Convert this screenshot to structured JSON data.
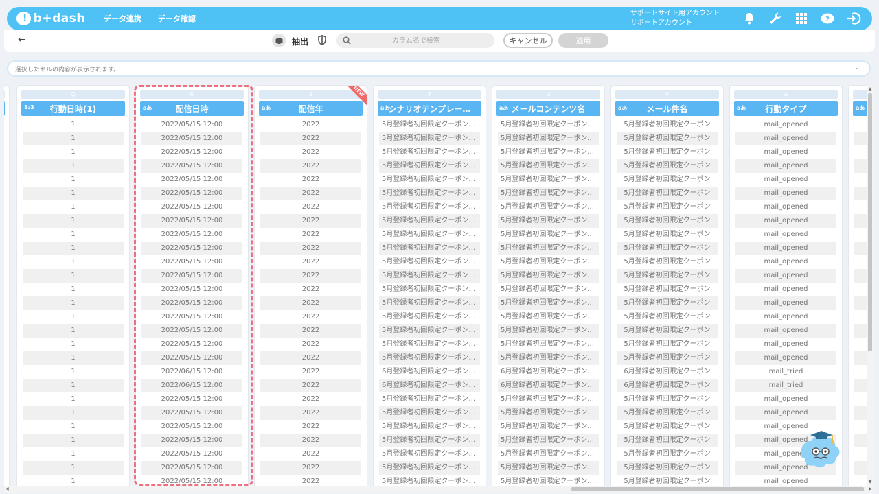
{
  "header": {
    "logo_text": "b+dash",
    "nav": [
      "データ連携",
      "データ確認"
    ],
    "account_line1": "サポートサイト用アカウント",
    "account_line2": "サポートアカウント",
    "icons": [
      "bell-icon",
      "wrench-icon",
      "grid-icon",
      "help-chat-icon",
      "logout-icon"
    ]
  },
  "toolbar": {
    "back": "←",
    "extract_label": "抽出",
    "search_placeholder": "カラム名で検索",
    "cancel_label": "キャンセル",
    "apply_label": "適用"
  },
  "cellbar": {
    "placeholder": "選択したセルの内容が表示されます。",
    "chevron": "⌄"
  },
  "columns": [
    {
      "letter": "Q",
      "type": "1₂3",
      "name": "行動日時(1)",
      "new": false,
      "align": "center",
      "cells": [
        "1",
        "1",
        "1",
        "1",
        "1",
        "1",
        "1",
        "1",
        "1",
        "1",
        "1",
        "1",
        "1",
        "1",
        "1",
        "1",
        "1",
        "1",
        "1",
        "1",
        "1",
        "1",
        "1",
        "1",
        "1",
        "1",
        "1"
      ]
    },
    {
      "letter": "R",
      "type": "aあ",
      "name": "配信日時",
      "new": false,
      "align": "center",
      "cells": [
        "2022/05/15 12:00",
        "2022/05/15 12:00",
        "2022/05/15 12:00",
        "2022/05/15 12:00",
        "2022/05/15 12:00",
        "2022/05/15 12:00",
        "2022/05/15 12:00",
        "2022/05/15 12:00",
        "2022/05/15 12:00",
        "2022/05/15 12:00",
        "2022/05/15 12:00",
        "2022/05/15 12:00",
        "2022/05/15 12:00",
        "2022/05/15 12:00",
        "2022/05/15 12:00",
        "2022/05/15 12:00",
        "2022/05/15 12:00",
        "2022/05/15 12:00",
        "2022/06/15 12:00",
        "2022/06/15 12:00",
        "2022/05/15 12:00",
        "2022/05/15 12:00",
        "2022/05/15 12:00",
        "2022/05/15 12:00",
        "2022/05/15 12:00",
        "2022/05/15 12:00",
        "2022/05/15 12:00"
      ]
    },
    {
      "letter": "S",
      "type": "aあ",
      "name": "配信年",
      "new": true,
      "new_label": "NEW",
      "align": "center",
      "cells": [
        "2022",
        "2022",
        "2022",
        "2022",
        "2022",
        "2022",
        "2022",
        "2022",
        "2022",
        "2022",
        "2022",
        "2022",
        "2022",
        "2022",
        "2022",
        "2022",
        "2022",
        "2022",
        "2022",
        "2022",
        "2022",
        "2022",
        "2022",
        "2022",
        "2022",
        "2022",
        "2022"
      ]
    },
    {
      "letter": "T",
      "type": "aあ",
      "name": "シナリオテンプレー…",
      "new": false,
      "align": "left",
      "cells": [
        "5月登録者初回限定クーポンシ…",
        "5月登録者初回限定クーポンシ…",
        "5月登録者初回限定クーポンシ…",
        "5月登録者初回限定クーポンシ…",
        "5月登録者初回限定クーポンシ…",
        "5月登録者初回限定クーポンシ…",
        "5月登録者初回限定クーポンシ…",
        "5月登録者初回限定クーポンシ…",
        "5月登録者初回限定クーポンシ…",
        "5月登録者初回限定クーポンシ…",
        "5月登録者初回限定クーポンシ…",
        "5月登録者初回限定クーポンシ…",
        "5月登録者初回限定クーポンシ…",
        "5月登録者初回限定クーポンシ…",
        "5月登録者初回限定クーポンシ…",
        "5月登録者初回限定クーポンシ…",
        "5月登録者初回限定クーポンシ…",
        "5月登録者初回限定クーポンシ…",
        "6月登録者初回限定クーポンシ…",
        "6月登録者初回限定クーポンシ…",
        "5月登録者初回限定クーポンシ…",
        "5月登録者初回限定クーポンシ…",
        "5月登録者初回限定クーポンシ…",
        "5月登録者初回限定クーポンシ…",
        "5月登録者初回限定クーポンシ…",
        "5月登録者初回限定クーポンシ…",
        "5月登録者初回限定クーポンシ…"
      ]
    },
    {
      "letter": "U",
      "type": "aあ",
      "name": "メールコンテンツ名",
      "new": false,
      "align": "left",
      "cells": [
        "5月登録者初回限定クーポンメ…",
        "5月登録者初回限定クーポンメ…",
        "5月登録者初回限定クーポンメ…",
        "5月登録者初回限定クーポンメ…",
        "5月登録者初回限定クーポンメ…",
        "5月登録者初回限定クーポンメ…",
        "5月登録者初回限定クーポンメ…",
        "5月登録者初回限定クーポンメ…",
        "5月登録者初回限定クーポンメ…",
        "5月登録者初回限定クーポンメ…",
        "5月登録者初回限定クーポンメ…",
        "5月登録者初回限定クーポンメ…",
        "5月登録者初回限定クーポンメ…",
        "5月登録者初回限定クーポンメ…",
        "5月登録者初回限定クーポンメ…",
        "5月登録者初回限定クーポンメ…",
        "5月登録者初回限定クーポンメ…",
        "5月登録者初回限定クーポンメ…",
        "6月登録者初回限定クーポンメ…",
        "6月登録者初回限定クーポンメ…",
        "5月登録者初回限定クーポンメ…",
        "5月登録者初回限定クーポンメ…",
        "5月登録者初回限定クーポンメ…",
        "5月登録者初回限定クーポンメ…",
        "5月登録者初回限定クーポンメ…",
        "5月登録者初回限定クーポンメ…",
        "5月登録者初回限定クーポンメ…"
      ]
    },
    {
      "letter": "V",
      "type": "aあ",
      "name": "メール件名",
      "new": false,
      "align": "center",
      "cells": [
        "5月登録者初回限定クーポン",
        "5月登録者初回限定クーポン",
        "5月登録者初回限定クーポン",
        "5月登録者初回限定クーポン",
        "5月登録者初回限定クーポン",
        "5月登録者初回限定クーポン",
        "5月登録者初回限定クーポン",
        "5月登録者初回限定クーポン",
        "5月登録者初回限定クーポン",
        "5月登録者初回限定クーポン",
        "5月登録者初回限定クーポン",
        "5月登録者初回限定クーポン",
        "5月登録者初回限定クーポン",
        "5月登録者初回限定クーポン",
        "5月登録者初回限定クーポン",
        "5月登録者初回限定クーポン",
        "5月登録者初回限定クーポン",
        "5月登録者初回限定クーポン",
        "6月登録者初回限定クーポン",
        "6月登録者初回限定クーポン",
        "5月登録者初回限定クーポン",
        "5月登録者初回限定クーポン",
        "5月登録者初回限定クーポン",
        "5月登録者初回限定クーポン",
        "5月登録者初回限定クーポン",
        "5月登録者初回限定クーポン",
        "5月登録者初回限定クーポン"
      ]
    },
    {
      "letter": "W",
      "type": "aあ",
      "name": "行動タイプ",
      "new": false,
      "align": "center",
      "cells": [
        "mail_opened",
        "mail_opened",
        "mail_opened",
        "mail_opened",
        "mail_opened",
        "mail_opened",
        "mail_opened",
        "mail_opened",
        "mail_opened",
        "mail_opened",
        "mail_opened",
        "mail_opened",
        "mail_opened",
        "mail_opened",
        "mail_opened",
        "mail_opened",
        "mail_opened",
        "mail_opened",
        "mail_tried",
        "mail_tried",
        "mail_opened",
        "mail_opened",
        "mail_opened",
        "mail_opened",
        "mail_opened",
        "mail_opened",
        "mail_opened"
      ]
    },
    {
      "letter": "",
      "type": "aあ",
      "name": "",
      "new": false,
      "align": "center",
      "cells": [
        "",
        "",
        "",
        "",
        "",
        "",
        "",
        "",
        "",
        "",
        "",
        "",
        "",
        "",
        "",
        "",
        "",
        "",
        "",
        "",
        "",
        "",
        "",
        "",
        "",
        "",
        ""
      ]
    }
  ],
  "colors": {
    "header_bg": "#4ec2f5",
    "column_header_bg": "#5ab6f2",
    "highlight_border": "#ee6f80",
    "new_ribbon": "#f06a6a"
  }
}
